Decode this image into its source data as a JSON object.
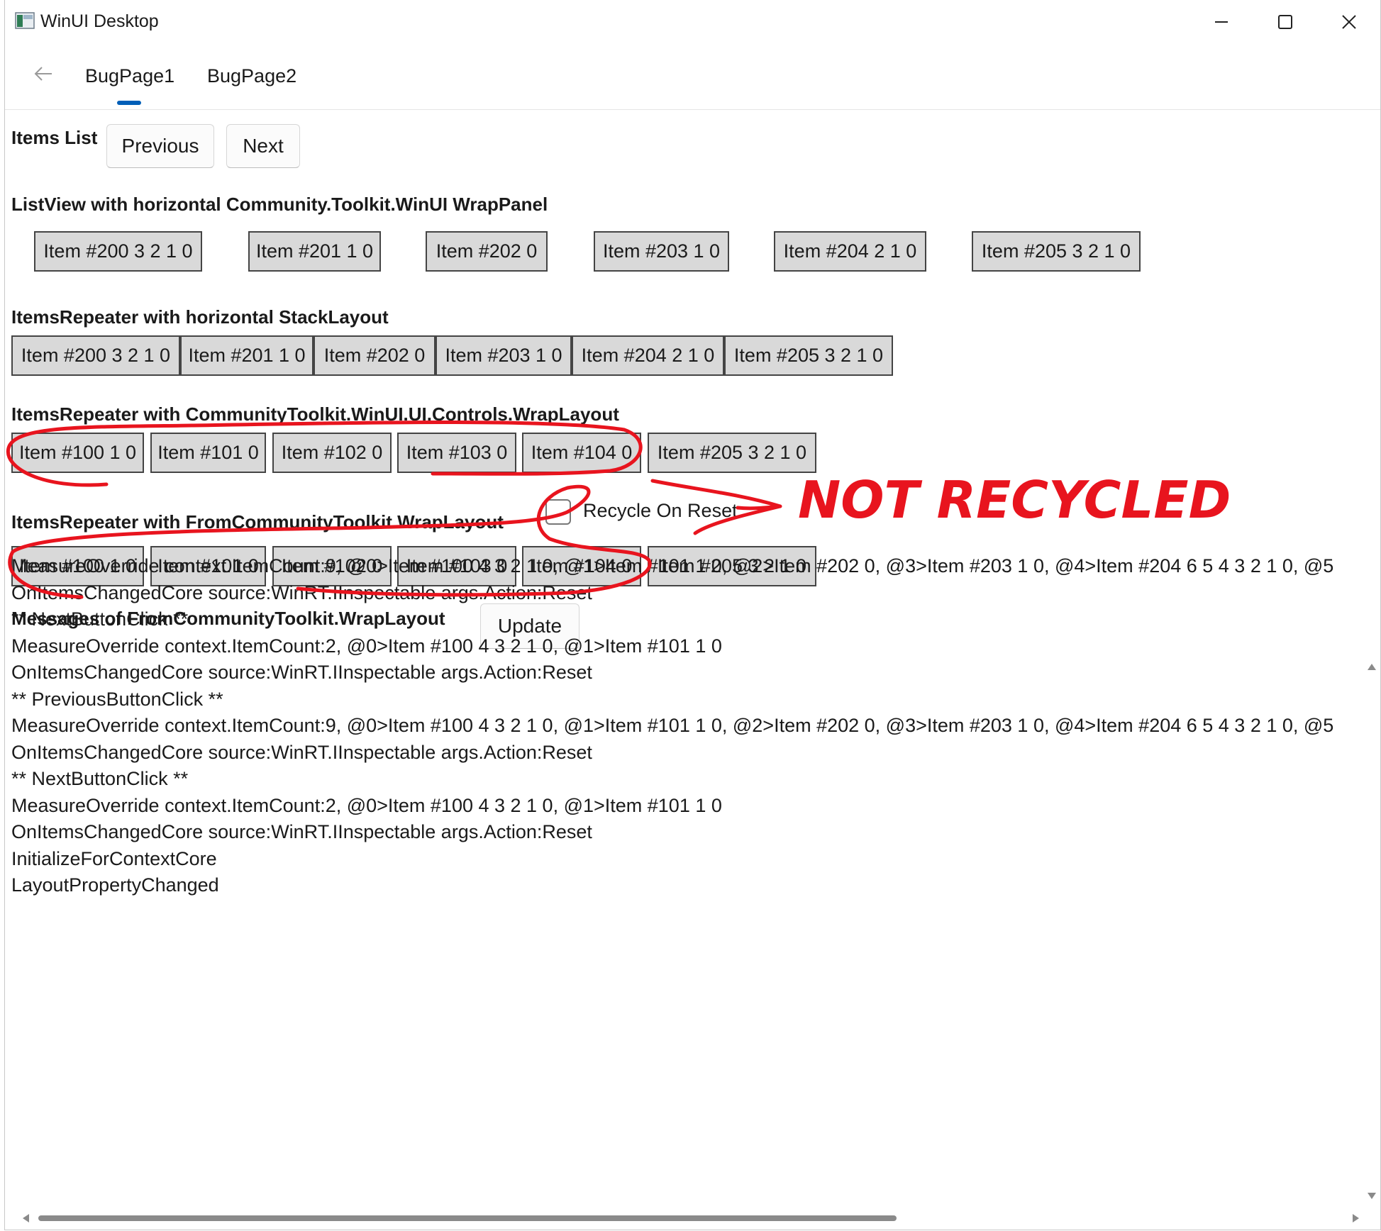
{
  "window": {
    "title": "WinUI Desktop"
  },
  "nav": {
    "tabs": [
      {
        "label": "BugPage1"
      },
      {
        "label": "BugPage2"
      }
    ]
  },
  "items_list": {
    "label": "Items List",
    "previous_label": "Previous",
    "next_label": "Next"
  },
  "section1": {
    "heading": "ListView with horizontal Community.Toolkit.WinUI WrapPanel",
    "items": [
      "Item #200 3 2 1 0",
      "Item #201 1 0",
      "Item #202 0",
      "Item #203 1 0",
      "Item #204 2 1 0",
      "Item #205 3 2 1 0"
    ]
  },
  "section2": {
    "heading": "ItemsRepeater with horizontal StackLayout",
    "items": [
      "Item #200 3 2 1 0",
      "Item #201 1 0",
      "Item #202 0",
      "Item #203 1 0",
      "Item #204 2 1 0",
      "Item #205 3 2 1 0"
    ]
  },
  "section3": {
    "heading": "ItemsRepeater with CommunityToolkit.WinUI.UI.Controls.WrapLayout",
    "items": [
      "Item #100 1 0",
      "Item #101 0",
      "Item #102 0",
      "Item #103 0",
      "Item #104 0",
      "Item #205 3 2 1 0"
    ]
  },
  "section4": {
    "heading": "ItemsRepeater with FromCommunityToolkit.WrapLayout",
    "recycle_label": "Recycle On Reset",
    "recycle_checked": false,
    "items": [
      "Item #100 1 0",
      "Item #101 0",
      "Item #102 0",
      "Item #103 0",
      "Item #104 0",
      "Item #205 3 2 1 0"
    ]
  },
  "messages": {
    "heading": "Messages of FromCommunityToolkit.WrapLayout",
    "update_label": "Update",
    "lines": [
      "MeasureOverride context.ItemCount:9, @0>Item #100 4 3 2 1 0, @1>Item #101 1 0, @2>Item #202 0, @3>Item #203 1 0, @4>Item #204 6 5 4 3 2 1 0, @5",
      "OnItemsChangedCore source:WinRT.IInspectable args.Action:Reset",
      "** NextButtonClick **",
      "MeasureOverride context.ItemCount:2, @0>Item #100 4 3 2 1 0, @1>Item #101 1 0",
      "OnItemsChangedCore source:WinRT.IInspectable args.Action:Reset",
      "** PreviousButtonClick **",
      "MeasureOverride context.ItemCount:9, @0>Item #100 4 3 2 1 0, @1>Item #101 1 0, @2>Item #202 0, @3>Item #203 1 0, @4>Item #204 6 5 4 3 2 1 0, @5",
      "OnItemsChangedCore source:WinRT.IInspectable args.Action:Reset",
      "** NextButtonClick **",
      "MeasureOverride context.ItemCount:2, @0>Item #100 4 3 2 1 0, @1>Item #101 1 0",
      "OnItemsChangedCore source:WinRT.IInspectable args.Action:Reset",
      "InitializeForContextCore",
      "LayoutPropertyChanged"
    ]
  },
  "annotation": {
    "text": "NOT RECYCLED",
    "color": "#e8141e"
  },
  "colors": {
    "accent": "#005fb8",
    "item_bg": "#d9d9d9"
  }
}
